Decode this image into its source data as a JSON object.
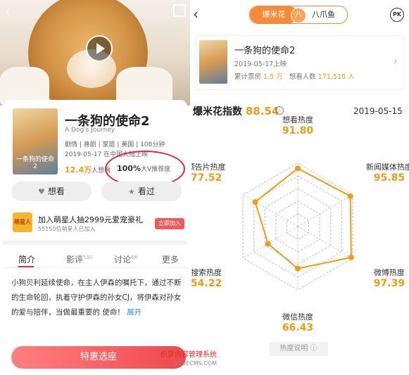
{
  "left": {
    "movie": {
      "title": "一条狗的使命2",
      "title_en": "A Dog's Journey",
      "genre": "剧情 | 喜剧 | 家庭 | 美国 | 108分钟",
      "release": "2019-05-17 在中国大陆上映",
      "want_count": "12.4万",
      "want_suffix": "人想看",
      "recommend_pct": "100%",
      "recommend_suffix": "大V推荐度"
    },
    "buttons": {
      "want": "想看",
      "seen": "看过",
      "buy": "特惠选座"
    },
    "promo": {
      "title": "加入萌星人抽2999元爱宠豪礼",
      "sub": "55150位萌星人已加入",
      "btn": "立即加入",
      "icon_text": "萌星人"
    },
    "tabs": [
      {
        "label": "简介",
        "count": ""
      },
      {
        "label": "影评",
        "count": "530"
      },
      {
        "label": "讨论",
        "count": "68"
      },
      {
        "label": "更多",
        "count": ""
      }
    ],
    "description": "小狗贝利延续使命，在主人伊森的嘱托下，通过不断的生命轮回，执着守护伊森的孙女CJ，将伊森对孙女的爱与陪伴，当做最重要的 使命！",
    "expand": "展开"
  },
  "right": {
    "seg": {
      "a": "爆米花",
      "mid": "八",
      "b": "八爪鱼"
    },
    "pk": "PK",
    "card": {
      "title": "一条狗的使命2",
      "date": "2019-05-17上映",
      "box_label": "累计票房",
      "box_value": "1.5 万",
      "want_label": "想看人数",
      "want_value": "171,510 人"
    },
    "index": {
      "label": "爆米花指数",
      "value": "88.54",
      "date": "2019-05-15"
    },
    "explain": "热度说明"
  },
  "chart_data": {
    "type": "radar",
    "categories": [
      "想看热度",
      "新闻媒体热度",
      "微博热度",
      "微信热度",
      "搜索热度",
      "预告片热度"
    ],
    "values": [
      91.8,
      95.85,
      97.39,
      66.43,
      54.22,
      77.52
    ],
    "range": [
      0,
      100
    ],
    "color": "#f39c12"
  },
  "watermark": {
    "line1": "织梦内容管理系统",
    "line2": "DEDECMS.COM"
  }
}
